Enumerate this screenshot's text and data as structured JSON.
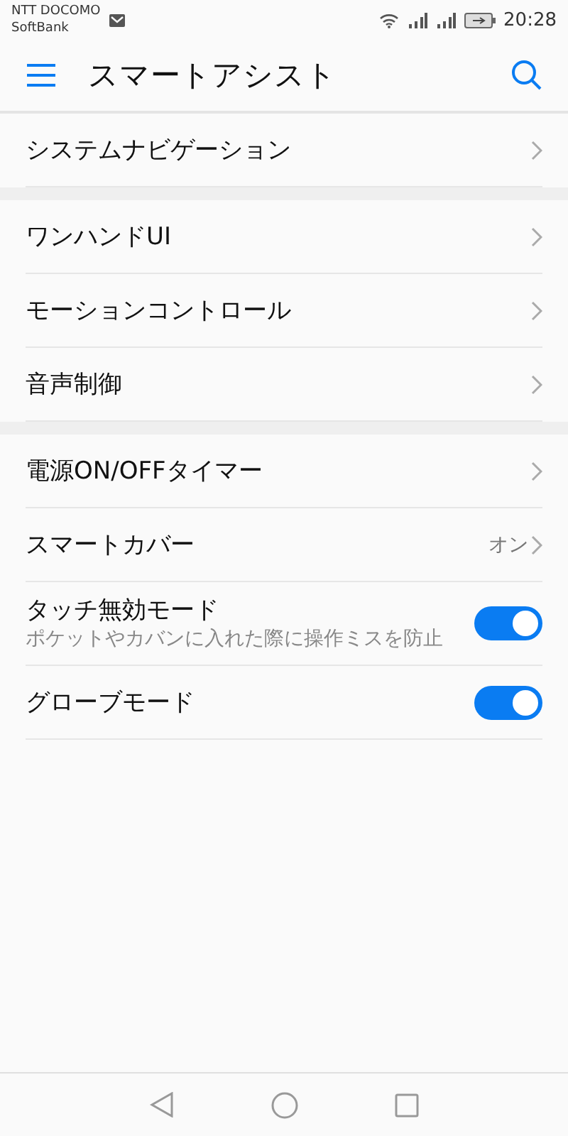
{
  "status_bar": {
    "carriers": [
      "NTT DOCOMO",
      "SoftBank"
    ],
    "time": "20:28"
  },
  "header": {
    "title": "スマートアシスト"
  },
  "sections": [
    {
      "items": [
        {
          "kind": "link",
          "label": "システムナビゲーション"
        }
      ]
    },
    {
      "items": [
        {
          "kind": "link",
          "label": "ワンハンドUI"
        },
        {
          "kind": "link",
          "label": "モーションコントロール"
        },
        {
          "kind": "link",
          "label": "音声制御"
        }
      ]
    },
    {
      "items": [
        {
          "kind": "link",
          "label": "電源ON/OFFタイマー"
        },
        {
          "kind": "link",
          "label": "スマートカバー",
          "value": "オン"
        },
        {
          "kind": "toggle",
          "label": "タッチ無効モード",
          "subtitle": "ポケットやカバンに入れた際に操作ミスを防止",
          "on": true
        },
        {
          "kind": "toggle",
          "label": "グローブモード",
          "on": true
        }
      ]
    }
  ]
}
